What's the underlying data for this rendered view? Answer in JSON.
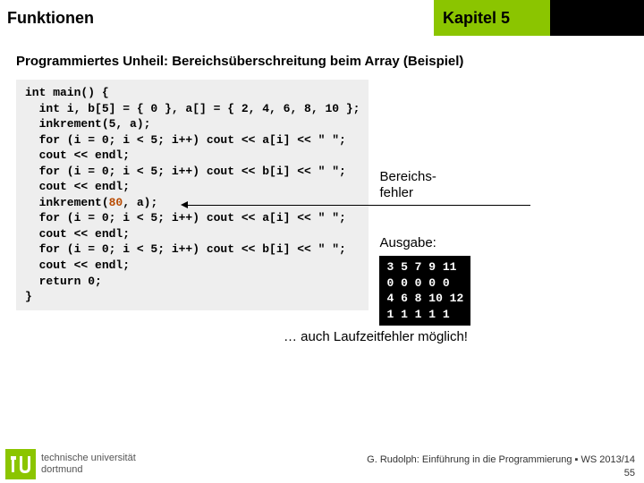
{
  "header": {
    "left_title": "Funktionen",
    "right_title": "Kapitel 5"
  },
  "subtitle": "Programmiertes Unheil: Bereichsüberschreitung beim Array (Beispiel)",
  "code": {
    "l1": "int main() {",
    "l2": "  int i, b[5] = { 0 }, a[] = { 2, 4, 6, 8, 10 };",
    "l3": "  inkrement(5, a);",
    "l4": "  for (i = 0; i < 5; i++) cout << a[i] << \" \";",
    "l5": "  cout << endl;",
    "l6": "  for (i = 0; i < 5; i++) cout << b[i] << \" \";",
    "l7": "  cout << endl;",
    "l8a": "  inkrement(",
    "l8hl": "80",
    "l8b": ", a);",
    "l9": "  for (i = 0; i < 5; i++) cout << a[i] << \" \";",
    "l10": "  cout << endl;",
    "l11": "  for (i = 0; i < 5; i++) cout << b[i] << \" \";",
    "l12": "  cout << endl;",
    "l13": "  return 0;",
    "l14": "}"
  },
  "side": {
    "bereichsfehler_l1": "Bereichs-",
    "bereichsfehler_l2": "fehler",
    "ausgabe": "Ausgabe:",
    "out1": "3 5 7 9 11",
    "out2": "0 0 0 0 0",
    "out3": "4 6 8 10 12",
    "out4": "1 1 1 1 1"
  },
  "runtime": "… auch Laufzeitfehler möglich!",
  "footer": {
    "logo_l1": "technische universität",
    "logo_l2": "dortmund",
    "credit": "G. Rudolph: Einführung in die Programmierung ▪ WS 2013/14",
    "page": "55"
  }
}
